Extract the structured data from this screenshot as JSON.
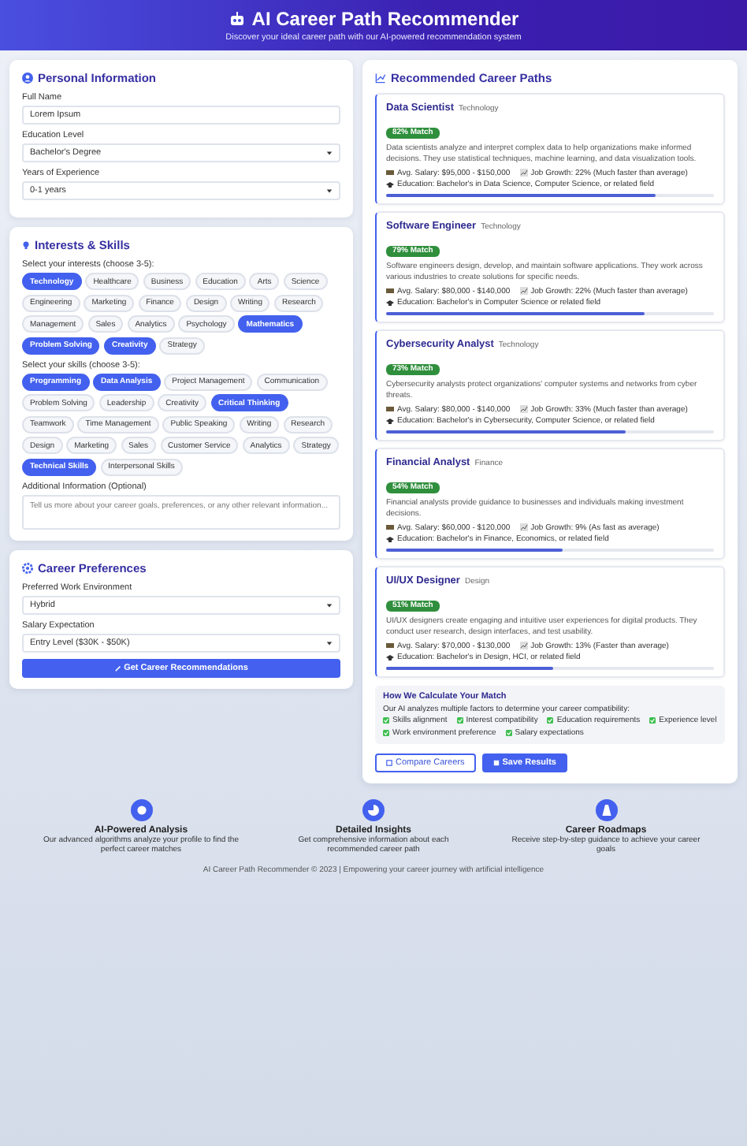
{
  "header": {
    "title": "AI Career Path Recommender",
    "subtitle": "Discover your ideal career path with our AI-powered recommendation system"
  },
  "personal": {
    "title": "Personal Information",
    "fields": [
      {
        "kind": "text",
        "label": "Full Name",
        "value": "Lorem Ipsum"
      },
      {
        "kind": "select",
        "label": "Education Level",
        "value": "Bachelor's Degree"
      },
      {
        "kind": "select",
        "label": "Years of Experience",
        "value": "0-1 years"
      }
    ]
  },
  "interests": {
    "title": "Interests & Skills",
    "groups": [
      {
        "label": "Select your interests (choose 3-5):",
        "chips": [
          {
            "label": "Technology",
            "selected": true
          },
          {
            "label": "Healthcare",
            "selected": false
          },
          {
            "label": "Business",
            "selected": false
          },
          {
            "label": "Education",
            "selected": false
          },
          {
            "label": "Arts",
            "selected": false
          },
          {
            "label": "Science",
            "selected": false
          },
          {
            "label": "Engineering",
            "selected": false
          },
          {
            "label": "Marketing",
            "selected": false
          },
          {
            "label": "Finance",
            "selected": false
          },
          {
            "label": "Design",
            "selected": false
          },
          {
            "label": "Writing",
            "selected": false
          },
          {
            "label": "Research",
            "selected": false
          },
          {
            "label": "Management",
            "selected": false
          },
          {
            "label": "Sales",
            "selected": false
          },
          {
            "label": "Analytics",
            "selected": false
          },
          {
            "label": "Psychology",
            "selected": false
          },
          {
            "label": "Mathematics",
            "selected": true
          },
          {
            "label": "Problem Solving",
            "selected": true
          },
          {
            "label": "Creativity",
            "selected": true
          },
          {
            "label": "Strategy",
            "selected": false
          }
        ]
      },
      {
        "label": "Select your skills (choose 3-5):",
        "chips": [
          {
            "label": "Programming",
            "selected": true
          },
          {
            "label": "Data Analysis",
            "selected": true
          },
          {
            "label": "Project Management",
            "selected": false
          },
          {
            "label": "Communication",
            "selected": false
          },
          {
            "label": "Problem Solving",
            "selected": false
          },
          {
            "label": "Leadership",
            "selected": false
          },
          {
            "label": "Creativity",
            "selected": false
          },
          {
            "label": "Critical Thinking",
            "selected": true
          },
          {
            "label": "Teamwork",
            "selected": false
          },
          {
            "label": "Time Management",
            "selected": false
          },
          {
            "label": "Public Speaking",
            "selected": false
          },
          {
            "label": "Writing",
            "selected": false
          },
          {
            "label": "Research",
            "selected": false
          },
          {
            "label": "Design",
            "selected": false
          },
          {
            "label": "Marketing",
            "selected": false
          },
          {
            "label": "Sales",
            "selected": false
          },
          {
            "label": "Customer Service",
            "selected": false
          },
          {
            "label": "Analytics",
            "selected": false
          },
          {
            "label": "Strategy",
            "selected": false
          },
          {
            "label": "Technical Skills",
            "selected": true
          },
          {
            "label": "Interpersonal Skills",
            "selected": false
          }
        ]
      }
    ],
    "notes": {
      "label": "Additional Information (Optional)",
      "placeholder": "Tell us more about your career goals, preferences, or any other relevant information..."
    }
  },
  "preferences": {
    "title": "Career Preferences",
    "fields": [
      {
        "kind": "select",
        "label": "Preferred Work Environment",
        "value": "Hybrid"
      },
      {
        "kind": "select",
        "label": "Salary Expectation",
        "value": "Entry Level ($30K - $50K)"
      }
    ],
    "submit": "Get Career Recommendations"
  },
  "results": {
    "title": "Recommended Career Paths",
    "careers": [
      {
        "title": "Data Scientist",
        "category": "Technology",
        "match": "82% Match",
        "level": 0.82,
        "description": "Data scientists analyze and interpret complex data to help organizations make informed decisions. They use statistical techniques, machine learning, and data visualization tools.",
        "salary": "Avg. Salary: $95,000 - $150,000",
        "growth": "Job Growth: 22% (Much faster than average)",
        "education": "Education: Bachelor's in Data Science, Computer Science, or related field"
      },
      {
        "title": "Software Engineer",
        "category": "Technology",
        "match": "79% Match",
        "level": 0.79,
        "description": "Software engineers design, develop, and maintain software applications. They work across various industries to create solutions for specific needs.",
        "salary": "Avg. Salary: $80,000 - $140,000",
        "growth": "Job Growth: 22% (Much faster than average)",
        "education": "Education: Bachelor's in Computer Science or related field"
      },
      {
        "title": "Cybersecurity Analyst",
        "category": "Technology",
        "match": "73% Match",
        "level": 0.73,
        "description": "Cybersecurity analysts protect organizations' computer systems and networks from cyber threats.",
        "salary": "Avg. Salary: $80,000 - $140,000",
        "growth": "Job Growth: 33% (Much faster than average)",
        "education": "Education: Bachelor's in Cybersecurity, Computer Science, or related field"
      },
      {
        "title": "Financial Analyst",
        "category": "Finance",
        "match": "54% Match",
        "level": 0.54,
        "description": "Financial analysts provide guidance to businesses and individuals making investment decisions.",
        "salary": "Avg. Salary: $60,000 - $120,000",
        "growth": "Job Growth: 9% (As fast as average)",
        "education": "Education: Bachelor's in Finance, Economics, or related field"
      },
      {
        "title": "UI/UX Designer",
        "category": "Design",
        "match": "51% Match",
        "level": 0.51,
        "description": "UI/UX designers create engaging and intuitive user experiences for digital products. They conduct user research, design interfaces, and test usability.",
        "salary": "Avg. Salary: $70,000 - $130,000",
        "growth": "Job Growth: 13% (Faster than average)",
        "education": "Education: Bachelor's in Design, HCI, or related field"
      }
    ],
    "method": {
      "title": "How We Calculate Your Match",
      "intro": "Our AI analyzes multiple factors to determine your career compatibility:",
      "factors": [
        "Skills alignment",
        "Interest compatibility",
        "Education requirements",
        "Experience level",
        "Work environment preference",
        "Salary expectations"
      ]
    },
    "actions": [
      {
        "kind": "outline",
        "label": "Compare Careers"
      },
      {
        "kind": "primary",
        "label": "Save Results"
      }
    ]
  },
  "features": [
    {
      "title": "AI-Powered Analysis",
      "text": "Our advanced algorithms analyze your profile to find the perfect career matches"
    },
    {
      "title": "Detailed Insights",
      "text": "Get comprehensive information about each recommended career path"
    },
    {
      "title": "Career Roadmaps",
      "text": "Receive step-by-step guidance to achieve your career goals"
    }
  ],
  "footer": "AI Career Path Recommender © 2023 | Empowering your career journey with artificial intelligence"
}
